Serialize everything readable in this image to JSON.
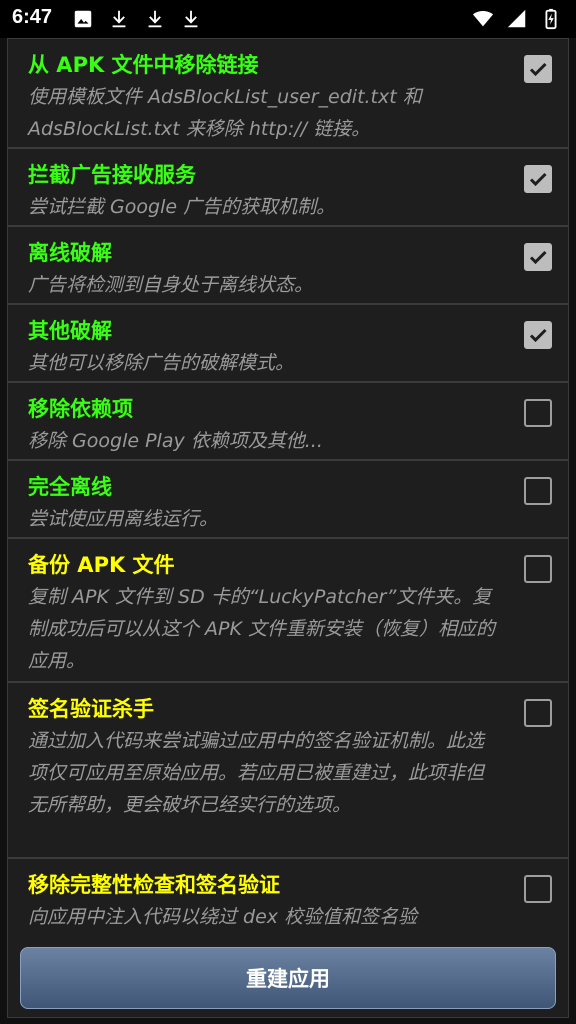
{
  "status_bar": {
    "time": "6:47",
    "left_icons": [
      "image-icon",
      "download-icon",
      "download-icon",
      "download-icon"
    ],
    "right_icons": [
      "wifi-icon",
      "signal-icon",
      "battery-charging-icon"
    ]
  },
  "colors": {
    "title_green": "#39ff14",
    "title_yellow": "#ffff00",
    "desc_gray": "#9a9a9a",
    "dialog_bg": "#1e1e1e"
  },
  "options": [
    {
      "title": "从 APK 文件中移除链接",
      "desc": "使用模板文件 AdsBlockList_user_edit.txt 和 AdsBlockList.txt 来移除 http:// 链接。",
      "checked": true,
      "color": "green"
    },
    {
      "title": "拦截广告接收服务",
      "desc": "尝试拦截 Google 广告的获取机制。",
      "checked": true,
      "color": "green"
    },
    {
      "title": "离线破解",
      "desc": "广告将检测到自身处于离线状态。",
      "checked": true,
      "color": "green"
    },
    {
      "title": "其他破解",
      "desc": "其他可以移除广告的破解模式。",
      "checked": true,
      "color": "green"
    },
    {
      "title": "移除依赖项",
      "desc": "移除 Google Play 依赖项及其他...",
      "checked": false,
      "color": "green"
    },
    {
      "title": "完全离线",
      "desc": "尝试使应用离线运行。",
      "checked": false,
      "color": "green"
    },
    {
      "title": "备份 APK 文件",
      "desc": "复制 APK 文件到 SD 卡的“LuckyPatcher”文件夹。复制成功后可以从这个 APK 文件重新安装（恢复）相应的应用。",
      "checked": false,
      "color": "yellow"
    },
    {
      "title": "签名验证杀手",
      "desc": "通过加入代码来尝试骗过应用中的签名验证机制。此选项仅可应用至原始应用。若应用已被重建过，此项非但无所帮助，更会破坏已经实行的选项。",
      "checked": false,
      "color": "yellow"
    },
    {
      "title": "移除完整性检查和签名验证",
      "desc": "向应用中注入代码以绕过 dex 校验值和签名验",
      "checked": false,
      "color": "yellow"
    }
  ],
  "rebuild_button": {
    "label": "重建应用"
  }
}
